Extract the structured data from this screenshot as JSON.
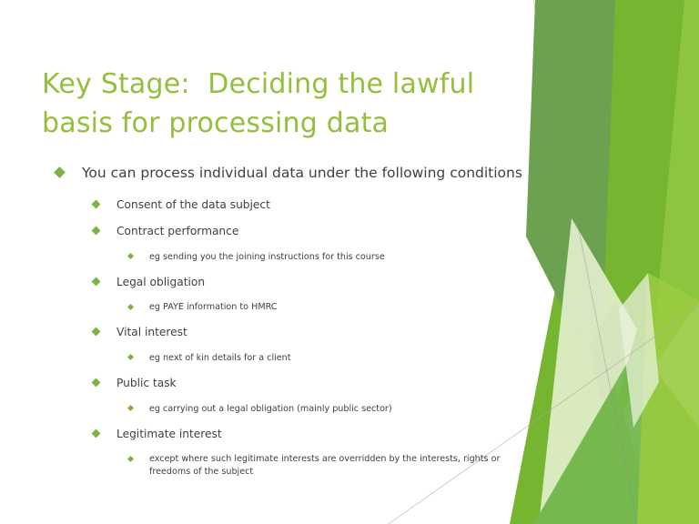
{
  "slide": {
    "title": "Key Stage:  Deciding the lawful basis for processing data",
    "title_color": "#94BF3D",
    "body_text_color": "#404040",
    "bullet_marker_color": "#7CB342",
    "background_color": "#FFFFFF"
  },
  "content": [
    {
      "level": 1,
      "text": "You can process individual data under the following conditions"
    },
    {
      "level": 2,
      "text": "Consent of the data subject"
    },
    {
      "level": 2,
      "text": "Contract performance"
    },
    {
      "level": 3,
      "text": "eg sending you the joining instructions for this course"
    },
    {
      "level": 2,
      "text": "Legal obligation"
    },
    {
      "level": 3,
      "text": "eg PAYE information to HMRC"
    },
    {
      "level": 2,
      "text": "Vital interest"
    },
    {
      "level": 3,
      "text": "eg next of kin details for a client"
    },
    {
      "level": 2,
      "text": "Public task"
    },
    {
      "level": 3,
      "text": "eg carrying out a legal obligation (mainly public sector)"
    },
    {
      "level": 2,
      "text": "Legitimate interest"
    },
    {
      "level": 3,
      "text": "except where such legitimate interests are overridden by the interests, rights or freedoms of the subject"
    }
  ],
  "decoration": {
    "name": "facet-corner-graphic",
    "colors": {
      "sage": "#6CA24F",
      "sage_dark": "#5E9443",
      "grass": "#76B52F",
      "lime": "#8CC63E",
      "lime_light": "#9ACB3F",
      "mid_green": "#74B84E",
      "pale": "#DCEBC4",
      "pale_light": "#E9F2D9",
      "deep": "#4E8C33",
      "hairline": "#A9A9A9"
    }
  }
}
